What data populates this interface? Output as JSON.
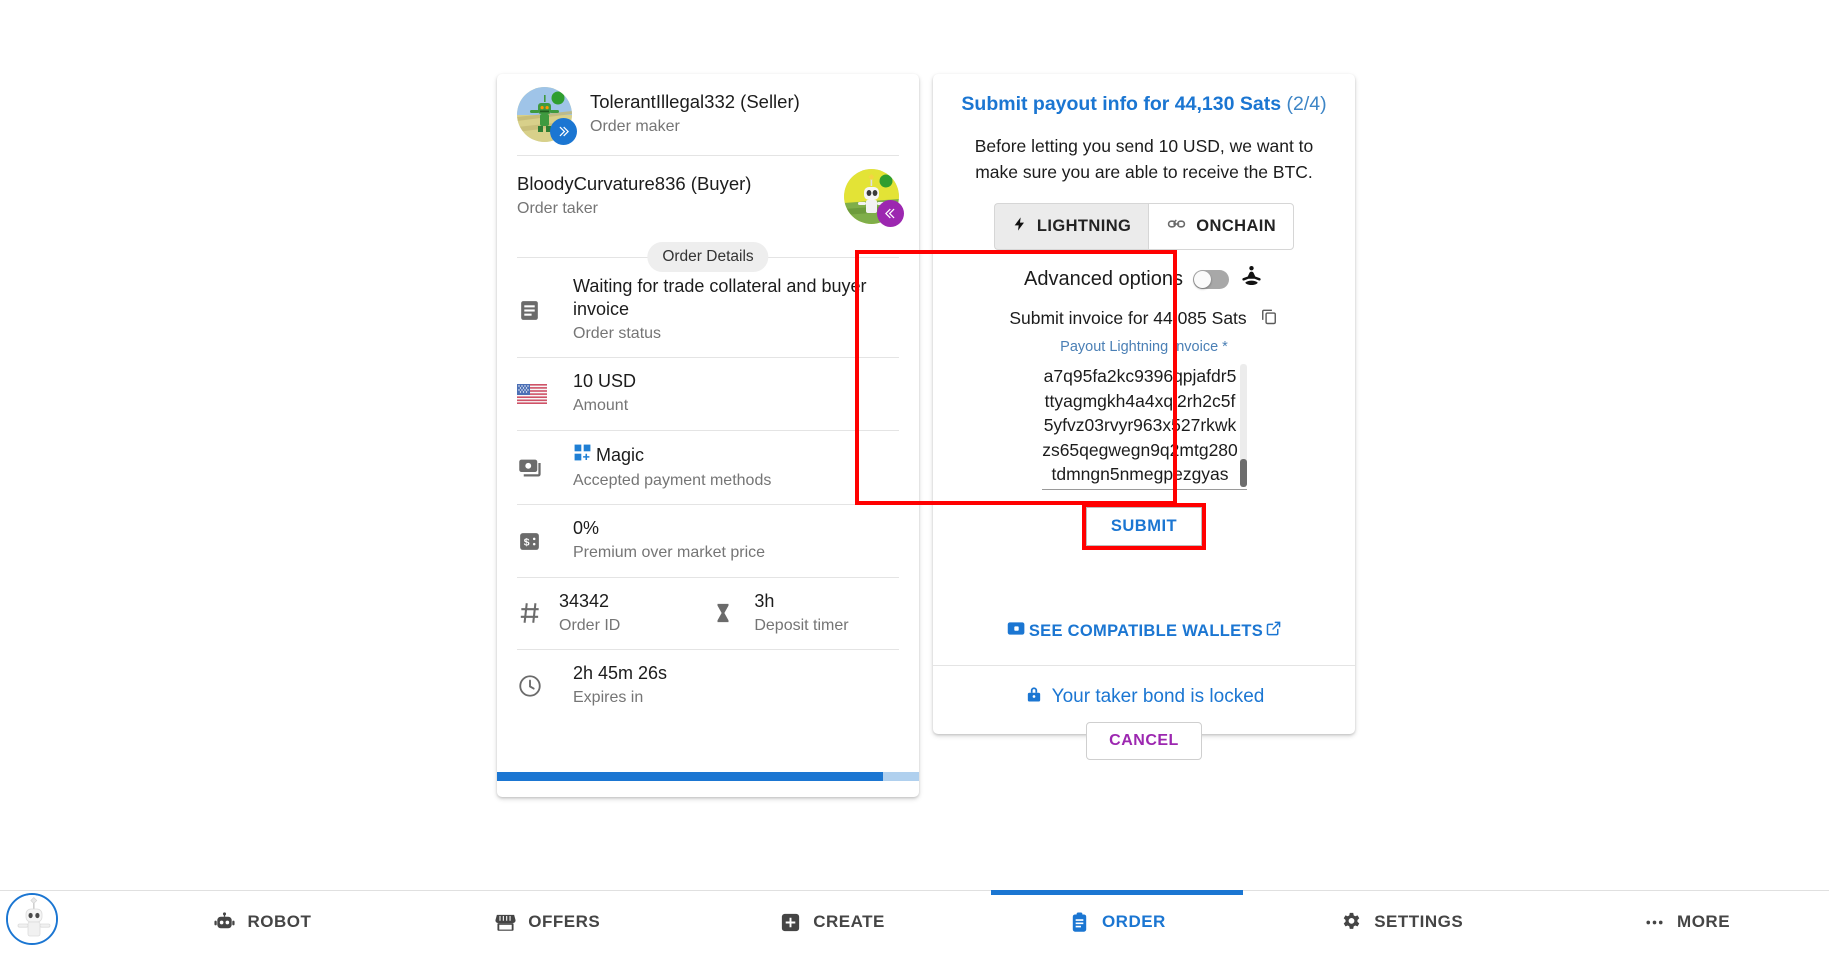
{
  "order_card": {
    "maker": {
      "name": "TolerantIllegal332 (Seller)",
      "role": "Order maker",
      "badge_icon": "double-chevron-right-icon"
    },
    "taker": {
      "name": "BloodyCurvature836 (Buyer)",
      "role": "Order taker",
      "badge_icon": "double-chevron-left-icon"
    },
    "details_chip": "Order Details",
    "rows": [
      {
        "icon": "article-icon",
        "primary": "Waiting for trade collateral and buyer invoice",
        "secondary": "Order status"
      },
      {
        "icon": "us-flag-icon",
        "primary": "10 USD",
        "secondary": "Amount"
      },
      {
        "icon": "payments-icon",
        "primary": "Magic",
        "secondary": "Accepted payment methods",
        "method_icon": "magic-squares-icon"
      },
      {
        "icon": "price-change-icon",
        "primary": "0%",
        "secondary": "Premium over market price"
      }
    ],
    "split_row": {
      "left": {
        "icon": "hash-icon",
        "primary": "34342",
        "secondary": "Order ID"
      },
      "right": {
        "icon": "hourglass-icon",
        "primary": "3h",
        "secondary": "Deposit timer"
      }
    },
    "expires_row": {
      "icon": "clock-icon",
      "primary": "2h 45m 26s",
      "secondary": "Expires in"
    },
    "progress_percent": 91.5
  },
  "payout_card": {
    "title_main": "Submit payout info for 44,130 Sats",
    "title_fraction": "(2/4)",
    "subtitle": "Before letting you send 10 USD, we want to make sure you are able to receive the BTC.",
    "segments": [
      {
        "label": "LIGHTNING",
        "icon": "bolt-icon",
        "selected": true
      },
      {
        "label": "ONCHAIN",
        "icon": "link-icon",
        "selected": false
      }
    ],
    "advanced_options": {
      "label": "Advanced options",
      "toggle_on": false,
      "icon": "self-improvement-icon"
    },
    "invoice": {
      "heading": "Submit invoice for 44,085 Sats",
      "copy_icon": "content-copy-icon",
      "field_label": "Payout Lightning Invoice *",
      "value": "a7q95fa2kc9396qpjafdr5ttyagmgkh4a4xql2rh2c5f5yfvz03rvyr963x527rkwkzs65qegwegn9q2mtg280tdmngn5nmegpezgyas",
      "submit_label": "SUBMIT"
    },
    "wallets_link": {
      "label": "SEE COMPATIBLE WALLETS",
      "left_icon": "wallet-icon",
      "right_icon": "open-in-new-icon"
    },
    "bond": {
      "label": "Your taker bond is locked",
      "icon": "lock-icon"
    },
    "cancel_label": "CANCEL"
  },
  "bottom_nav": {
    "items": [
      {
        "label": "ROBOT",
        "icon": "robot-icon",
        "active": false
      },
      {
        "label": "OFFERS",
        "icon": "storefront-icon",
        "active": false
      },
      {
        "label": "CREATE",
        "icon": "add-box-icon",
        "active": false
      },
      {
        "label": "ORDER",
        "icon": "assignment-icon",
        "active": true
      },
      {
        "label": "SETTINGS",
        "icon": "settings-icon",
        "active": false
      },
      {
        "label": "MORE",
        "icon": "more-horiz-icon",
        "active": false
      }
    ]
  },
  "colors": {
    "accent": "#1b76d2",
    "highlight": "#ff0000",
    "cancel": "#9c27b0",
    "muted": "#757575"
  }
}
